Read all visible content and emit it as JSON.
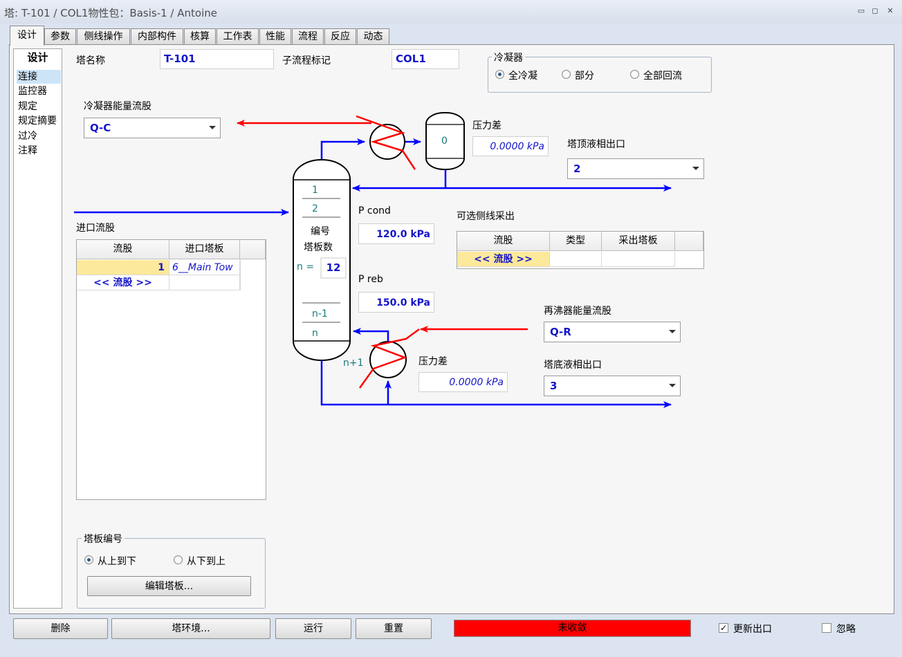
{
  "window": {
    "title": "塔: T-101 / COL1物性包：Basis-1 / Antoine",
    "minimize_glyph": "▭",
    "restore_glyph": "◻",
    "close_glyph": "✕"
  },
  "tabs": [
    "设计",
    "参数",
    "侧线操作",
    "内部构件",
    "核算",
    "工作表",
    "性能",
    "流程",
    "反应",
    "动态"
  ],
  "nav": {
    "header": "设计",
    "items": [
      "连接",
      "监控器",
      "规定",
      "规定摘要",
      "过冷",
      "注释"
    ]
  },
  "form": {
    "column_name_label": "塔名称",
    "column_name_value": "T-101",
    "subflow_label": "子流程标记",
    "subflow_value": "COL1",
    "condenser_energy_label": "冷凝器能量流股",
    "condenser_energy_value": "Q-C",
    "pressure_drop_label_top": "压力差",
    "pressure_drop_top_value": "0.0000 kPa",
    "top_liquid_outlet_label": "塔顶液相出口",
    "top_liquid_outlet_value": "2",
    "p_cond_label": "P cond",
    "p_cond_value": "120.0 kPa",
    "p_reb_label": "P reb",
    "p_reb_value": "150.0 kPa",
    "reboiler_energy_label": "再沸器能量流股",
    "reboiler_energy_value": "Q-R",
    "pressure_drop_label_bottom": "压力差",
    "pressure_drop_bottom_value": "0.0000 kPa",
    "bottom_liquid_outlet_label": "塔底液相出口",
    "bottom_liquid_outlet_value": "3"
  },
  "condenser": {
    "group_title": "冷凝器",
    "options": [
      "全冷凝",
      "部分",
      "全部回流"
    ],
    "selected": "全冷凝"
  },
  "diagram": {
    "condenser_drum_label": "0",
    "stage_1": "1",
    "stage_2": "2",
    "stage_title_1": "编号",
    "stage_title_2": "塔板数",
    "n_label": "n =",
    "n_value": "12",
    "stage_n_minus_1": "n-1",
    "stage_n": "n",
    "stage_n_plus_1": "n+1"
  },
  "inlet_streams": {
    "title": "进口流股",
    "columns": [
      "流股",
      "进口塔板"
    ],
    "rows": [
      {
        "stream": "1",
        "stage": "6__Main Tow"
      }
    ],
    "add_row": "<< 流股 >>"
  },
  "side_draws": {
    "title": "可选侧线采出",
    "columns": [
      "流股",
      "类型",
      "采出塔板"
    ],
    "add_row": "<< 流股 >>"
  },
  "stage_numbering": {
    "group_title": "塔板编号",
    "options": [
      "从上到下",
      "从下到上"
    ],
    "selected": "从上到下",
    "edit_button": "编辑塔板..."
  },
  "bottom_bar": {
    "delete": "删除",
    "environment": "塔环境...",
    "run": "运行",
    "reset": "重置",
    "status": "未收敛",
    "update_outlets_label": "更新出口",
    "update_outlets_checked": true,
    "ignore_label": "忽略",
    "ignore_checked": false
  },
  "colors": {
    "energy_stream": "#ff0000",
    "material_stream": "#0000ff",
    "status_unconverged": "#ff0000",
    "value_text": "#1515c8",
    "stage_text": "#1a7a7a"
  }
}
